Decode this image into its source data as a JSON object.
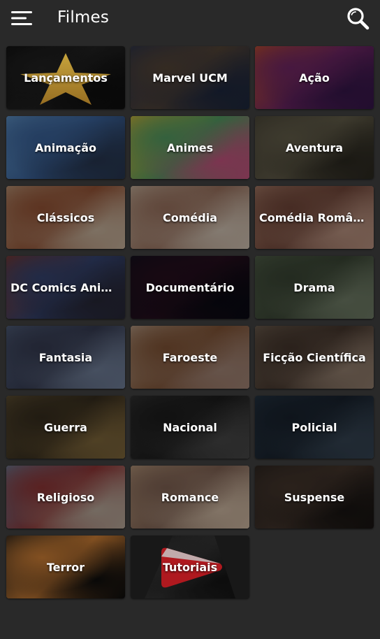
{
  "header": {
    "title": "Filmes",
    "menu_icon": "hamburger-menu-icon",
    "search_icon": "search-icon"
  },
  "categories": [
    {
      "label": "Lançamentos",
      "icon": "star-icon",
      "colors": [
        "#0b0b0b",
        "#1a1a1a",
        "#0b0b0b"
      ]
    },
    {
      "label": "Marvel UCM",
      "colors": [
        "#2b3550",
        "#5a4a3c",
        "#1f2a44"
      ]
    },
    {
      "label": "Ação",
      "colors": [
        "#d35a2a",
        "#7a2a6e",
        "#3a1850"
      ]
    },
    {
      "label": "Animação",
      "colors": [
        "#6aa3d9",
        "#3f6aa6",
        "#2a3a55"
      ]
    },
    {
      "label": "Animes",
      "colors": [
        "#e9c43a",
        "#5aa86a",
        "#d65a8a"
      ]
    },
    {
      "label": "Aventura",
      "colors": [
        "#4a4638",
        "#6b6550",
        "#2e2b22"
      ]
    },
    {
      "label": "Clássicos",
      "colors": [
        "#c9a98a",
        "#a05a3a",
        "#d8c2aa"
      ]
    },
    {
      "label": "Comédia",
      "colors": [
        "#d9c6b0",
        "#a67b66",
        "#e3d3c2"
      ]
    },
    {
      "label": "Comédia Romântica",
      "colors": [
        "#b88a74",
        "#7a4c3e",
        "#caa08c"
      ]
    },
    {
      "label": "DC Comics Animações",
      "colors": [
        "#8a3a2a",
        "#3a4a7a",
        "#2a2a3a"
      ]
    },
    {
      "label": "Documentário",
      "colors": [
        "#121220",
        "#2a1020",
        "#0a0a14"
      ]
    },
    {
      "label": "Drama",
      "colors": [
        "#5a6a52",
        "#3e4a38",
        "#7a8870"
      ]
    },
    {
      "label": "Fantasia",
      "colors": [
        "#5a6a88",
        "#3a4058",
        "#7a8aa6"
      ]
    },
    {
      "label": "Faroeste",
      "colors": [
        "#c9b09a",
        "#8a5a3a",
        "#b09080"
      ]
    },
    {
      "label": "Ficção Científica",
      "colors": [
        "#7a6a5a",
        "#4a3a30",
        "#a08a78"
      ]
    },
    {
      "label": "Guerra",
      "colors": [
        "#6a5a3a",
        "#3a3020",
        "#8a7040"
      ]
    },
    {
      "label": "Nacional",
      "colors": [
        "#3a3a3a",
        "#1e1e1e",
        "#4e4e4e"
      ]
    },
    {
      "label": "Policial",
      "colors": [
        "#2a3a4a",
        "#1a2430",
        "#3a4a5a"
      ]
    },
    {
      "label": "Religioso",
      "colors": [
        "#6a8aa8",
        "#9a3a3a",
        "#c8b8a8"
      ]
    },
    {
      "label": "Romance",
      "colors": [
        "#c8a888",
        "#8a6a5a",
        "#e0c8b0"
      ]
    },
    {
      "label": "Suspense",
      "colors": [
        "#2a2420",
        "#4a3a30",
        "#1a1614"
      ]
    },
    {
      "label": "Terror",
      "colors": [
        "#1a1a1a",
        "#e08a3a",
        "#0e0e0e"
      ]
    },
    {
      "label": "Tutoriais",
      "icon": "play-icon",
      "colors": [
        "#151515",
        "#2a2a2a",
        "#101010"
      ]
    }
  ],
  "colors": {
    "background": "#292929",
    "text": "#ffffff",
    "tutorial_play": "#d61f26"
  }
}
